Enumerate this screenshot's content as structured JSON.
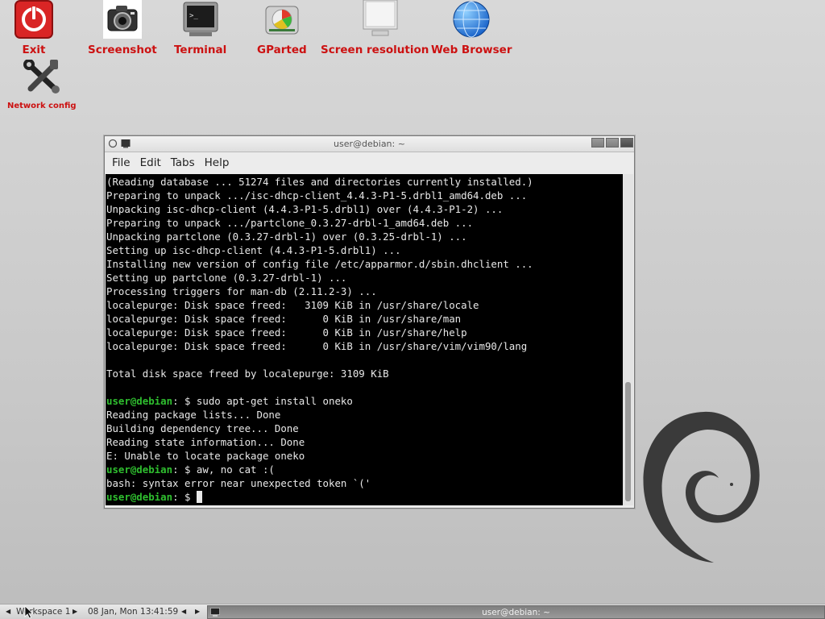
{
  "desktop_icons": [
    {
      "id": "exit",
      "label": "Exit",
      "icon": "power-icon"
    },
    {
      "id": "screenshot",
      "label": "Screenshot",
      "icon": "camera-icon"
    },
    {
      "id": "terminal",
      "label": "Terminal",
      "icon": "terminal-icon"
    },
    {
      "id": "gparted",
      "label": "GParted",
      "icon": "disk-icon"
    },
    {
      "id": "screen-resolution",
      "label": "Screen resolution",
      "icon": "monitor-icon"
    },
    {
      "id": "web-browser",
      "label": "Web Browser",
      "icon": "globe-icon"
    },
    {
      "id": "network-config",
      "label": "Network config",
      "icon": "wrench-icon"
    }
  ],
  "terminal": {
    "title": "user@debian: ~",
    "menu": [
      "File",
      "Edit",
      "Tabs",
      "Help"
    ],
    "prompt": "user@debian",
    "lines": [
      {
        "text": "(Reading database ... 51274 files and directories currently installed.)"
      },
      {
        "text": "Preparing to unpack .../isc-dhcp-client_4.4.3-P1-5.drbl1_amd64.deb ..."
      },
      {
        "text": "Unpacking isc-dhcp-client (4.4.3-P1-5.drbl1) over (4.4.3-P1-2) ..."
      },
      {
        "text": "Preparing to unpack .../partclone_0.3.27-drbl-1_amd64.deb ..."
      },
      {
        "text": "Unpacking partclone (0.3.27-drbl-1) over (0.3.25-drbl-1) ..."
      },
      {
        "text": "Setting up isc-dhcp-client (4.4.3-P1-5.drbl1) ..."
      },
      {
        "text": "Installing new version of config file /etc/apparmor.d/sbin.dhclient ..."
      },
      {
        "text": "Setting up partclone (0.3.27-drbl-1) ..."
      },
      {
        "text": "Processing triggers for man-db (2.11.2-3) ..."
      },
      {
        "text": "localepurge: Disk space freed:   3109 KiB in /usr/share/locale"
      },
      {
        "text": "localepurge: Disk space freed:      0 KiB in /usr/share/man"
      },
      {
        "text": "localepurge: Disk space freed:      0 KiB in /usr/share/help"
      },
      {
        "text": "localepurge: Disk space freed:      0 KiB in /usr/share/vim/vim90/lang"
      },
      {
        "text": ""
      },
      {
        "text": "Total disk space freed by localepurge: 3109 KiB"
      },
      {
        "text": ""
      },
      {
        "prompt": true,
        "text": ": $ sudo apt-get install oneko"
      },
      {
        "text": "Reading package lists... Done"
      },
      {
        "text": "Building dependency tree... Done"
      },
      {
        "text": "Reading state information... Done"
      },
      {
        "text": "E: Unable to locate package oneko"
      },
      {
        "prompt": true,
        "text": ": $ aw, no cat :("
      },
      {
        "text": "bash: syntax error near unexpected token `('"
      },
      {
        "prompt": true,
        "text": ": $ ",
        "cursor": true
      }
    ]
  },
  "taskbar": {
    "workspace": "Workspace 1",
    "clock": "08 Jan, Mon 13:41:59",
    "task_title": "user@debian: ~"
  },
  "colors": {
    "label_red": "#cc1111",
    "prompt_green": "#2fbf2f",
    "terminal_bg": "#000000"
  }
}
